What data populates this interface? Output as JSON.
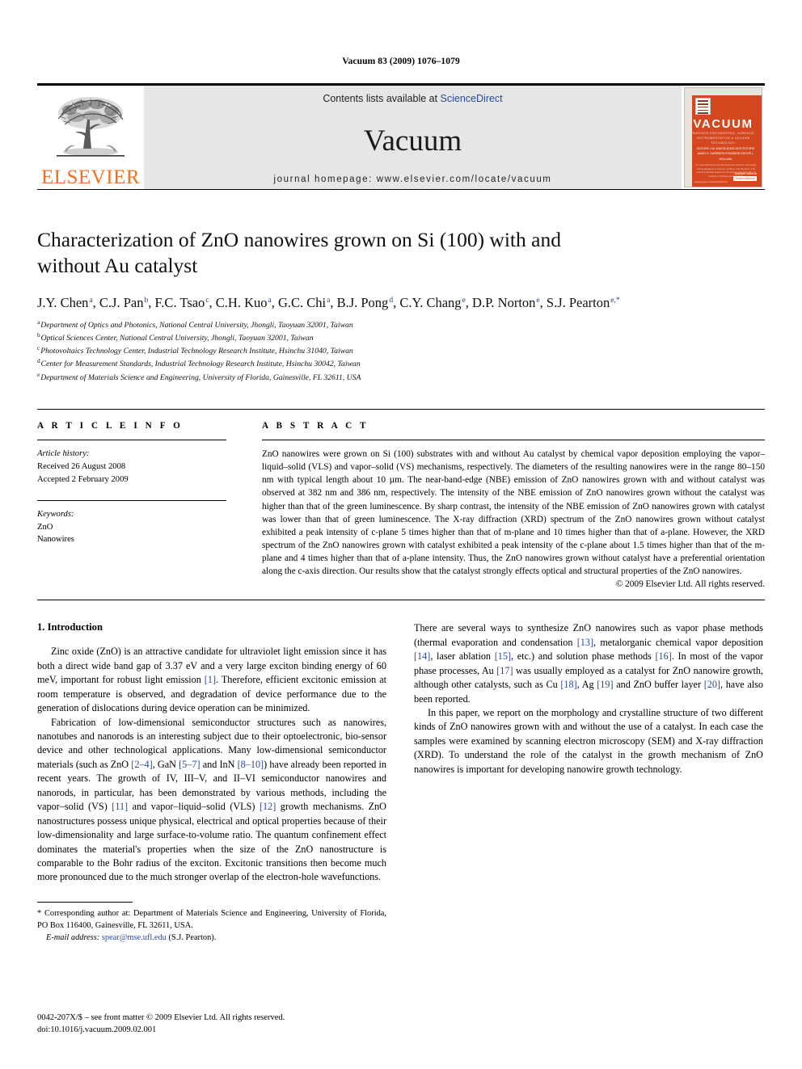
{
  "running_head": "Vacuum 83 (2009) 1076–1079",
  "masthead": {
    "publisher_name": "ELSEVIER",
    "contents_prefix": "Contents lists available at ",
    "contents_link": "ScienceDirect",
    "journal_name": "Vacuum",
    "homepage": "journal homepage: www.elsevier.com/locate/vacuum",
    "cover": {
      "title": "VACUUM",
      "subtitle": "SURFACE ENGINEERING, SURFACE INSTRUMENTATION\n& VACUUM TECHNOLOGY",
      "authors": "EDITORS  J.W.  ANSON       ASSOCIATE  EDITORS  JAMES  E.  HARRISON\nFOUNDING EDITOR       L. HOLLAND",
      "abstract_lines": "An international journal devoted to the science, technology and applications of vacuum, surfaces and thin films. The journal publishes papers on the physics and chemistry of surfaces, interfaces and thin films.",
      "science_direct": "ScienceDirect",
      "available_label": "Available online at",
      "url": "www.elsevier.com/locate/vacuum"
    }
  },
  "article": {
    "title": "Characterization of ZnO nanowires grown on Si (100) with and without Au catalyst",
    "authors": [
      {
        "name": "J.Y. Chen",
        "sup": "a"
      },
      {
        "name": "C.J. Pan",
        "sup": "b"
      },
      {
        "name": "F.C. Tsao",
        "sup": "c"
      },
      {
        "name": "C.H. Kuo",
        "sup": "a"
      },
      {
        "name": "G.C. Chi",
        "sup": "a"
      },
      {
        "name": "B.J. Pong",
        "sup": "d"
      },
      {
        "name": "C.Y. Chang",
        "sup": "e"
      },
      {
        "name": "D.P. Norton",
        "sup": "e"
      },
      {
        "name": "S.J. Pearton",
        "sup": "e,*"
      }
    ],
    "affiliations": [
      {
        "sup": "a",
        "text": "Department of Optics and Photonics, National Central University, Jhongli, Taoyuan 32001, Taiwan"
      },
      {
        "sup": "b",
        "text": "Optical Sciences Center, National Central University, Jhongli, Taoyuan 32001, Taiwan"
      },
      {
        "sup": "c",
        "text": "Photovoltaics Technology Center, Industrial Technology Research Institute, Hsinchu 31040, Taiwan"
      },
      {
        "sup": "d",
        "text": "Center for Measurement Standards, Industrial Technology Research Institute, Hsinchu 30042, Taiwan"
      },
      {
        "sup": "e",
        "text": "Department of Materials Science and Engineering, University of Florida, Gainesville, FL 32611, USA"
      }
    ]
  },
  "article_info": {
    "heading": "A R T I C L E   I N F O",
    "history_label": "Article history:",
    "received": "Received 26 August 2008",
    "accepted": "Accepted 2 February 2009",
    "keywords_label": "Keywords:",
    "keywords": [
      "ZnO",
      "Nanowires"
    ]
  },
  "abstract": {
    "heading": "A B S T R A C T",
    "text": "ZnO nanowires were grown on Si (100) substrates with and without Au catalyst by chemical vapor deposition employing the vapor–liquid–solid (VLS) and vapor–solid (VS) mechanisms, respectively. The diameters of the resulting nanowires were in the range 80–150 nm with typical length about 10 µm. The near-band-edge (NBE) emission of ZnO nanowires grown with and without catalyst was observed at 382 nm and 386 nm, respectively. The intensity of the NBE emission of ZnO nanowires grown without the catalyst was higher than that of the green luminescence. By sharp contrast, the intensity of the NBE emission of ZnO nanowires grown with catalyst was lower than that of green luminescence. The X-ray diffraction (XRD) spectrum of the ZnO nanowires grown without catalyst exhibited a peak intensity of c-plane 5 times higher than that of m-plane and 10 times higher than that of a-plane. However, the XRD spectrum of the ZnO nanowires grown with catalyst exhibited a peak intensity of the c-plane about 1.5 times higher than that of the m-plane and 4 times higher than that of a-plane intensity. Thus, the ZnO nanowires grown without catalyst have a preferential orientation along the c-axis direction. Our results show that the catalyst strongly effects optical and structural properties of the ZnO nanowires.",
    "copyright": "© 2009 Elsevier Ltd. All rights reserved."
  },
  "introduction": {
    "heading": "1. Introduction",
    "p1_a": "Zinc oxide (ZnO) is an attractive candidate for ultraviolet light emission since it has both a direct wide band gap of 3.37 eV and a very large exciton binding energy of 60 meV, important for robust light emission ",
    "p1_ref": "[1]",
    "p1_b": ". Therefore, efficient excitonic emission at room temperature is observed, and degradation of device performance due to the generation of dislocations during device operation can be minimized.",
    "p2_a": "Fabrication of low-dimensional semiconductor structures such as nanowires, nanotubes and nanorods is an interesting subject due to their optoelectronic, bio-sensor device and other technological applications. Many low-dimensional semiconductor materials (such as ZnO ",
    "p2_r1": "[2–4]",
    "p2_b": ", GaN ",
    "p2_r2": "[5–7]",
    "p2_c": " and InN ",
    "p2_r3": "[8–10]",
    "p2_d": ") have already been reported in recent years. The growth of IV, III–V, and II–VI semiconductor nanowires and nanorods, in particular, has been demonstrated by various methods, including the vapor–solid (VS) ",
    "p2_r4": "[11]",
    "p2_e": " and vapor–liquid–solid (VLS) ",
    "p2_r5": "[12]",
    "p2_f": " growth mechanisms. ZnO nanostructures possess unique physical, electrical and optical properties because of their low-dimensionality and large surface-to-volume ratio. The quantum confinement effect dominates the material's properties when the size of the ZnO nanostructure is comparable to the Bohr radius of the exciton. Excitonic transitions then become much more pronounced due to the much stronger overlap of the electron-hole wavefunctions.",
    "p3_a": "There are several ways to synthesize ZnO nanowires such as vapor phase methods (thermal evaporation and condensation ",
    "p3_r1": "[13]",
    "p3_b": ", metalorganic chemical vapor deposition ",
    "p3_r2": "[14]",
    "p3_c": ", laser ablation ",
    "p3_r3": "[15]",
    "p3_d": ", etc.) and solution phase methods ",
    "p3_r4": "[16]",
    "p3_e": ". In most of the vapor phase processes, Au ",
    "p3_r5": "[17]",
    "p3_f": " was usually employed as a catalyst for ZnO nanowire growth, although other catalysts, such as Cu ",
    "p3_r6": "[18]",
    "p3_g": ", Ag ",
    "p3_r7": "[19]",
    "p3_h": " and ZnO buffer layer ",
    "p3_r8": "[20]",
    "p3_i": ", have also been reported.",
    "p4": "In this paper, we report on the morphology and crystalline structure of two different kinds of ZnO nanowires grown with and without the use of a catalyst. In each case the samples were examined by scanning electron microscopy (SEM) and X-ray diffraction (XRD). To understand the role of the catalyst in the growth mechanism of ZnO nanowires is important for developing nanowire growth technology."
  },
  "footnote": {
    "corresponding": "* Corresponding author at: Department of Materials Science and Engineering, University of Florida, PO Box 116400, Gainesville, FL 32611, USA.",
    "email_label": "E-mail address:",
    "email": "spear@mse.ufl.edu",
    "email_suffix": " (S.J. Pearton)."
  },
  "page_footer": {
    "issn_line": "0042-207X/$ – see front matter © 2009 Elsevier Ltd. All rights reserved.",
    "doi_line": "doi:10.1016/j.vacuum.2009.02.001"
  }
}
